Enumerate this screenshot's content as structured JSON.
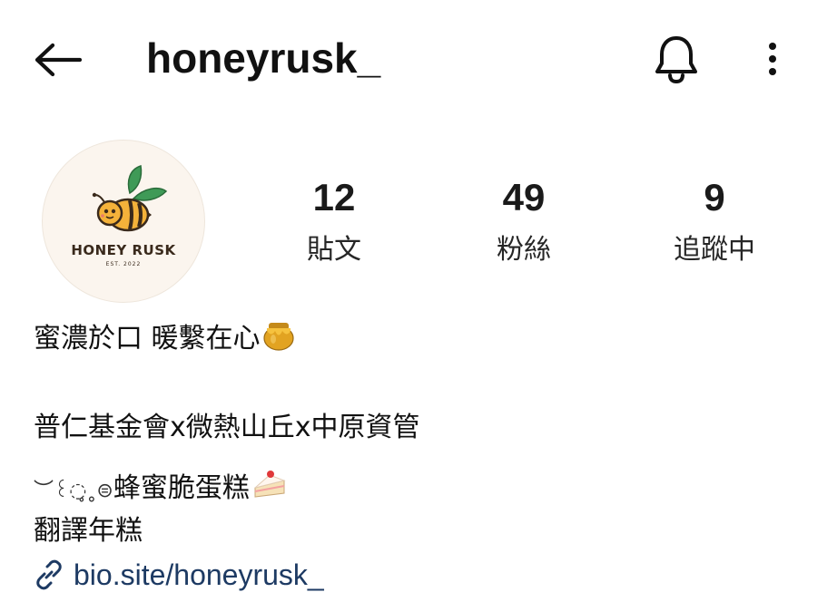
{
  "header": {
    "username": "honeyrusk_"
  },
  "profile": {
    "avatar": {
      "brand_text": "HONEY RUSK",
      "est_text": "EST. 2022",
      "colors": {
        "background": "#fbf5ee",
        "leaf": "#3f9a57",
        "bee_body": "#f4b23a",
        "stripe": "#3a2a1c"
      }
    },
    "stats": [
      {
        "value": "12",
        "label": "貼文"
      },
      {
        "value": "49",
        "label": "粉絲"
      },
      {
        "value": "9",
        "label": "追蹤中"
      }
    ]
  },
  "bio": {
    "line1": "蜜濃於口 暖繫在心",
    "line1_emoji": "honey-pot-icon",
    "line2": "普仁基金會x微熱山丘x中原資管",
    "line3": "蜂蜜脆蛋糕",
    "line3_prefix": "︶꒰◌̥˳⊜",
    "line3_emoji": "shortcake-icon",
    "line4": "翻譯年糕"
  },
  "link": {
    "icon": "link-icon",
    "text": "bio.site/honeyrusk_",
    "color": "#1d3a63"
  }
}
